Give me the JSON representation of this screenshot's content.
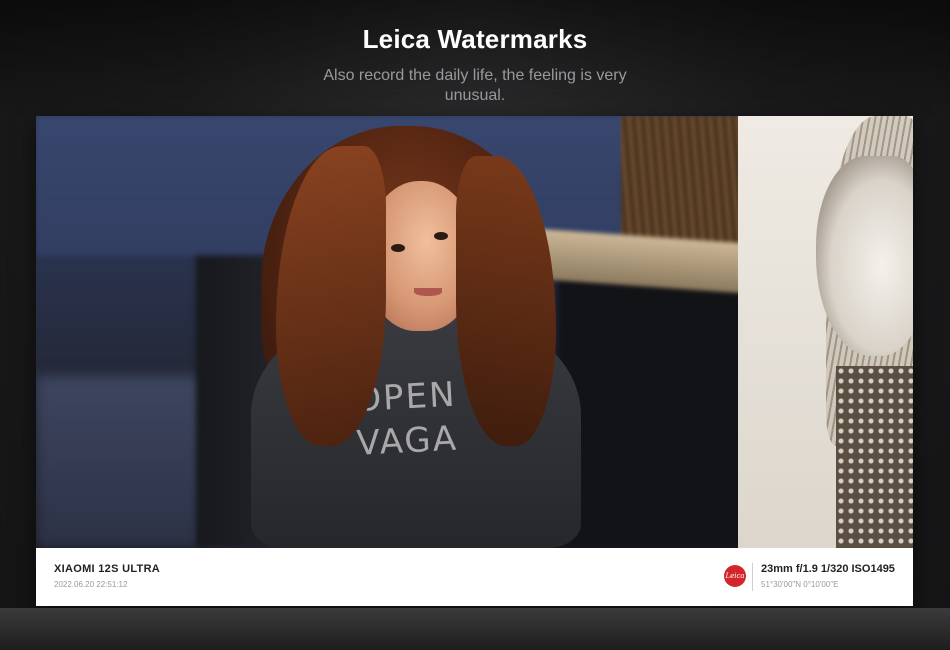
{
  "header": {
    "title": "Leica Watermarks",
    "subtitle": "Also record the daily life, the feeling is very unusual."
  },
  "watermark": {
    "device_model": "XIAOMI 12S ULTRA",
    "datetime": "2022.06.20 22:51:12",
    "logo_text": "Leica",
    "exif": "23mm f/1.9 1/320 ISO1495",
    "gps": "51°30'00\"N  0°10'00\"E"
  },
  "photo": {
    "hoodie_print": "OPEN\nVAGA"
  },
  "colors": {
    "background": "#1c1c1d",
    "title": "#ffffff",
    "subtitle": "#9a9a9c",
    "leica_red": "#d3262b"
  }
}
